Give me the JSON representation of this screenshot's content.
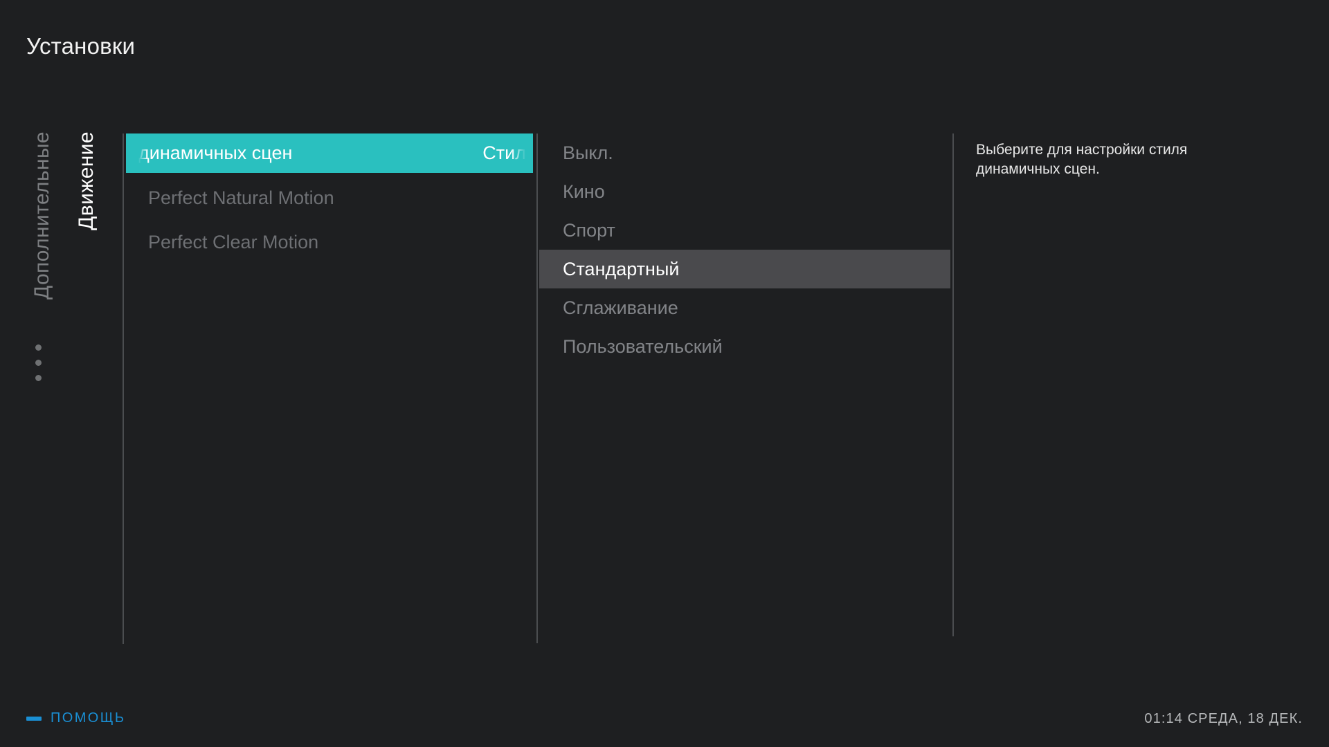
{
  "header": {
    "title": "Установки"
  },
  "rail": {
    "previous_category": "Дополнительные",
    "active_category": "Движение",
    "overflow_icon": "vertical-ellipsis-icon"
  },
  "items_column": {
    "items": [
      {
        "label": "динамичных сцен",
        "value": "Стил",
        "selected": true
      },
      {
        "label": "Perfect Natural Motion",
        "value": "",
        "selected": false
      },
      {
        "label": "Perfect Clear Motion",
        "value": "",
        "selected": false
      }
    ]
  },
  "options_column": {
    "options": [
      {
        "label": "Выкл.",
        "selected": false
      },
      {
        "label": "Кино",
        "selected": false
      },
      {
        "label": "Спорт",
        "selected": false
      },
      {
        "label": "Стандартный",
        "selected": true
      },
      {
        "label": "Сглаживание",
        "selected": false
      },
      {
        "label": "Пользовательский",
        "selected": false
      }
    ]
  },
  "description": {
    "text": "Выберите для настройки стиля динамичных сцен."
  },
  "footer": {
    "help_label": "ПОМОЩЬ",
    "help_icon": "blue-dash-icon",
    "clock": "01:14 СРЕДА, 18 ДЕК."
  },
  "colors": {
    "background": "#1e1f21",
    "accent_cyan": "#2ac0bf",
    "selected_gray": "#4a4a4d",
    "help_blue": "#1a8fd4",
    "dim_text": "#7d7f82",
    "divider": "#4b4d50"
  }
}
